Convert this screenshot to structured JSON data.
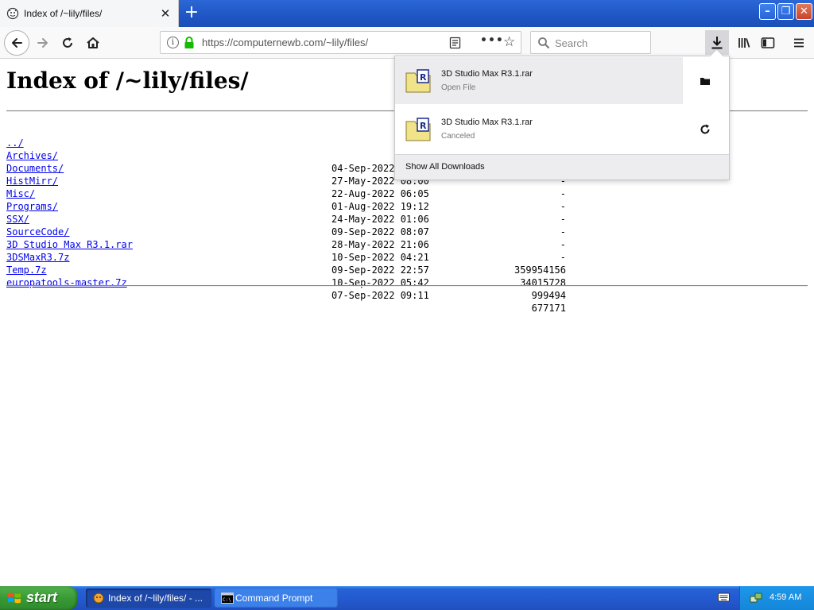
{
  "browser": {
    "tab_title": "Index of /~lily/files/",
    "url": "https://computernewb.com/~lily/files/",
    "search_placeholder": "Search"
  },
  "page": {
    "heading": "Index of /~lily/files/",
    "entries": [
      {
        "name": "../",
        "date": "",
        "size": ""
      },
      {
        "name": "Archives/",
        "date": "04-Sep-2022 20:02",
        "size": "-"
      },
      {
        "name": "Documents/",
        "date": "27-May-2022 08:00",
        "size": "-"
      },
      {
        "name": "HistMirr/",
        "date": "22-Aug-2022 06:05",
        "size": "-"
      },
      {
        "name": "Misc/",
        "date": "01-Aug-2022 19:12",
        "size": "-"
      },
      {
        "name": "Programs/",
        "date": "24-May-2022 01:06",
        "size": "-"
      },
      {
        "name": "SSX/",
        "date": "09-Sep-2022 08:07",
        "size": "-"
      },
      {
        "name": "SourceCode/",
        "date": "28-May-2022 21:06",
        "size": "-"
      },
      {
        "name": "3D Studio Max R3.1.rar",
        "date": "10-Sep-2022 04:21",
        "size": "359954156"
      },
      {
        "name": "3DSMaxR3.7z",
        "date": "09-Sep-2022 22:57",
        "size": "34015728"
      },
      {
        "name": "Temp.7z",
        "date": "10-Sep-2022 05:42",
        "size": "999494"
      },
      {
        "name": "europatools-master.7z",
        "date": "07-Sep-2022 09:11",
        "size": "677171"
      }
    ]
  },
  "downloads": {
    "items": [
      {
        "name": "3D Studio Max R3.1.rar",
        "status": "Open File",
        "action_icon": "folder-icon"
      },
      {
        "name": "3D Studio Max R3.1.rar",
        "status": "Canceled",
        "action_icon": "retry-icon"
      }
    ],
    "footer_label": "Show All Downloads"
  },
  "taskbar": {
    "start_label": "start",
    "tasks": [
      {
        "label": "Index of /~lily/files/ - ..."
      },
      {
        "label": "Command Prompt"
      }
    ],
    "clock": "4:59 AM"
  },
  "colors": {
    "link": "#0000ee",
    "titlebar": "#1f56c4",
    "start_green": "#3a9a36"
  }
}
